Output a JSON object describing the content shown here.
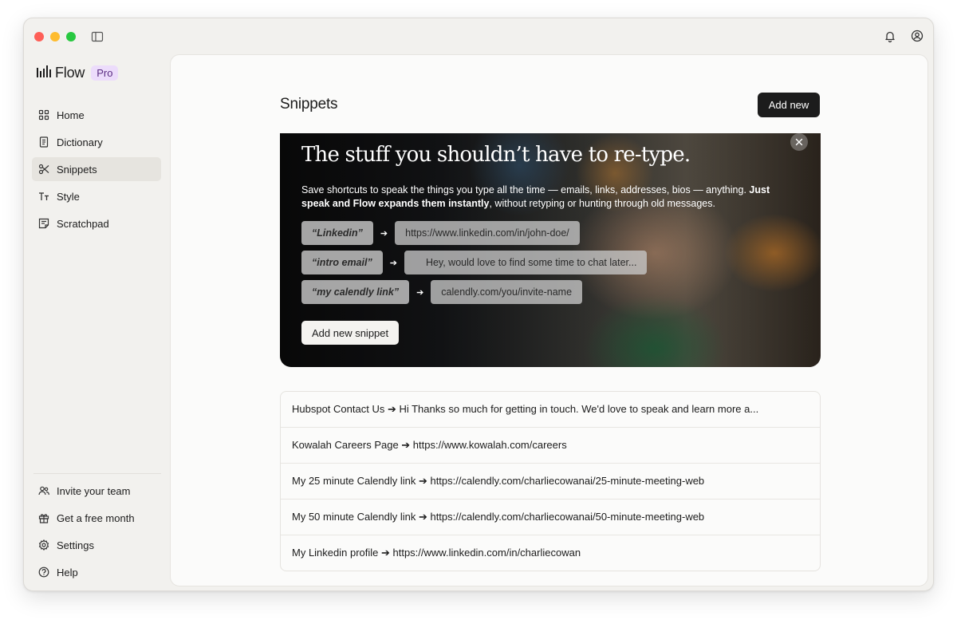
{
  "app": {
    "name": "Flow",
    "badge": "Pro"
  },
  "sidebar": {
    "items": [
      {
        "label": "Home",
        "icon": "grid-icon"
      },
      {
        "label": "Dictionary",
        "icon": "book-icon"
      },
      {
        "label": "Snippets",
        "icon": "scissors-icon",
        "active": true
      },
      {
        "label": "Style",
        "icon": "text-style-icon"
      },
      {
        "label": "Scratchpad",
        "icon": "note-icon"
      }
    ],
    "bottom_items": [
      {
        "label": "Invite your team",
        "icon": "users-icon"
      },
      {
        "label": "Get a free month",
        "icon": "gift-icon"
      },
      {
        "label": "Settings",
        "icon": "gear-icon"
      },
      {
        "label": "Help",
        "icon": "help-icon"
      }
    ]
  },
  "main": {
    "title": "Snippets",
    "add_new_label": "Add new",
    "banner": {
      "heading": "The stuff you shouldn’t have to re-type.",
      "description_plain": "Save shortcuts to speak the things you type all the time — emails, links, addresses, bios — anything.",
      "description_bold": "Just speak and Flow expands them instantly",
      "description_tail": ", without retyping or hunting through old messages.",
      "examples": [
        {
          "trigger": "“Linkedin”",
          "expansion": "https://www.linkedin.com/in/john-doe/"
        },
        {
          "trigger": "“intro email”",
          "expansion": "Hey, would love to find some time to chat later..."
        },
        {
          "trigger": "“my calendly link”",
          "expansion": "calendly.com/you/invite-name"
        }
      ],
      "arrow": "➔",
      "add_snippet_label": "Add new snippet"
    },
    "snippets": [
      "Hubspot Contact Us ➔ Hi Thanks so much for getting in touch. We'd love to speak and learn more a...",
      "Kowalah Careers Page ➔ https://www.kowalah.com/careers",
      "My 25 minute Calendly link ➔ https://calendly.com/charliecowanai/25-minute-meeting-web",
      "My 50 minute Calendly link ➔ https://calendly.com/charliecowanai/50-minute-meeting-web",
      "My Linkedin profile ➔ https://www.linkedin.com/in/charliecowan"
    ]
  }
}
